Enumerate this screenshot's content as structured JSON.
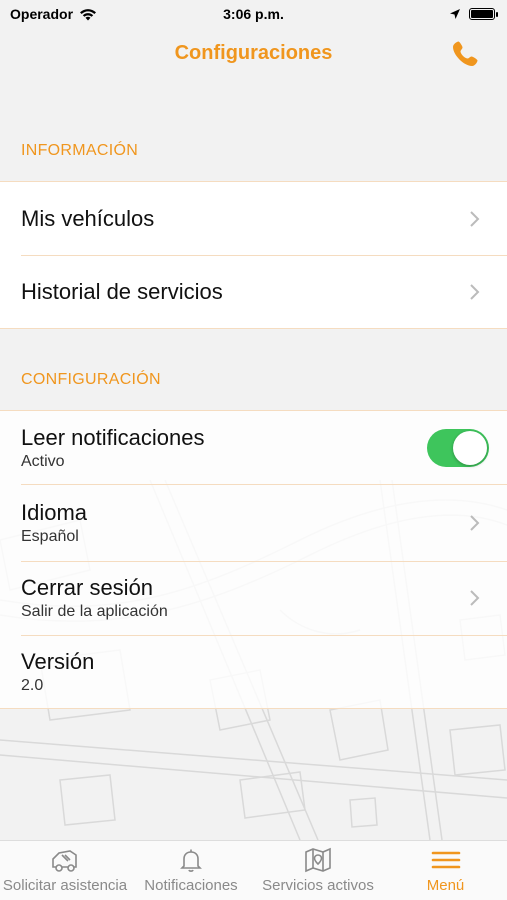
{
  "status_bar": {
    "carrier": "Operador",
    "time": "3:06 p.m."
  },
  "nav": {
    "title": "Configuraciones",
    "phone_icon": "phone-icon"
  },
  "sections": {
    "info": {
      "header": "INFORMACIÓN",
      "items": [
        {
          "title": "Mis vehículos"
        },
        {
          "title": "Historial de servicios"
        }
      ]
    },
    "config": {
      "header": "CONFIGURACIÓN",
      "items": [
        {
          "title": "Leer notificaciones",
          "subtitle": "Activo",
          "toggle_on": true
        },
        {
          "title": "Idioma",
          "subtitle": "Español"
        },
        {
          "title": "Cerrar sesión",
          "subtitle": "Salir de la aplicación"
        },
        {
          "title": "Versión",
          "subtitle": "2.0"
        }
      ]
    }
  },
  "tabs": [
    {
      "label": "Solicitar asistencia",
      "icon": "tow-truck-icon",
      "active": false
    },
    {
      "label": "Notificaciones",
      "icon": "bell-icon",
      "active": false
    },
    {
      "label": "Servicios activos",
      "icon": "map-icon",
      "active": false
    },
    {
      "label": "Menú",
      "icon": "menu-icon",
      "active": true
    }
  ],
  "colors": {
    "accent": "#f0961e",
    "toggle_on": "#3ec55c",
    "inactive_tab": "#8a8a8a"
  }
}
